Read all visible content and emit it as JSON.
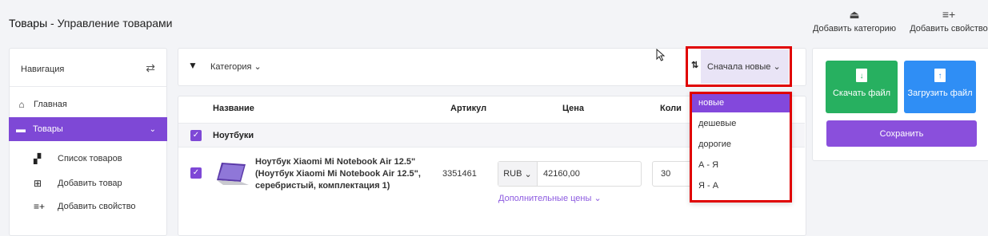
{
  "header": {
    "title_bold": "Товары",
    "title_rest": " - Управление товарами",
    "actions": [
      {
        "label": "Добавить категорию",
        "icon": "tray-upload-icon"
      },
      {
        "label": "Добавить свойство",
        "icon": "list-plus-icon"
      }
    ]
  },
  "sidebar": {
    "heading": "Навигация",
    "items": [
      {
        "label": "Главная",
        "icon": "home-icon"
      },
      {
        "label": "Товары",
        "icon": "box-icon",
        "active": true
      }
    ],
    "subitems": [
      {
        "label": "Список товаров",
        "icon": "boxes-icon"
      },
      {
        "label": "Добавить товар",
        "icon": "plus-square-icon"
      },
      {
        "label": "Добавить свойство",
        "icon": "list-plus-icon"
      }
    ]
  },
  "filter": {
    "category_label": "Категория",
    "sort_label": "Сначала новые"
  },
  "table": {
    "headers": [
      "Название",
      "Артикул",
      "Цена",
      "Коли"
    ],
    "group": "Ноутбуки",
    "rows": [
      {
        "name": "Ноутбук Xiaomi Mi Notebook Air 12.5\" (Ноутбук Xiaomi Mi Notebook Air 12.5\", серебристый, комплектация 1)",
        "sku": "3351461",
        "currency": "RUB",
        "price": "42160,00",
        "qty": "30",
        "extra_prices": "Дополнительные цены"
      }
    ]
  },
  "sort_dropdown": {
    "options": [
      "новые",
      "дешевые",
      "дорогие",
      "А - Я",
      "Я - А"
    ],
    "selected_index": 0
  },
  "actions": {
    "download": "Скачать файл",
    "upload": "Загрузить файл",
    "save": "Сохранить"
  },
  "colors": {
    "accent": "#7e48d6",
    "download": "#27b060",
    "upload": "#2f8ef5",
    "highlight": "#e00000"
  }
}
